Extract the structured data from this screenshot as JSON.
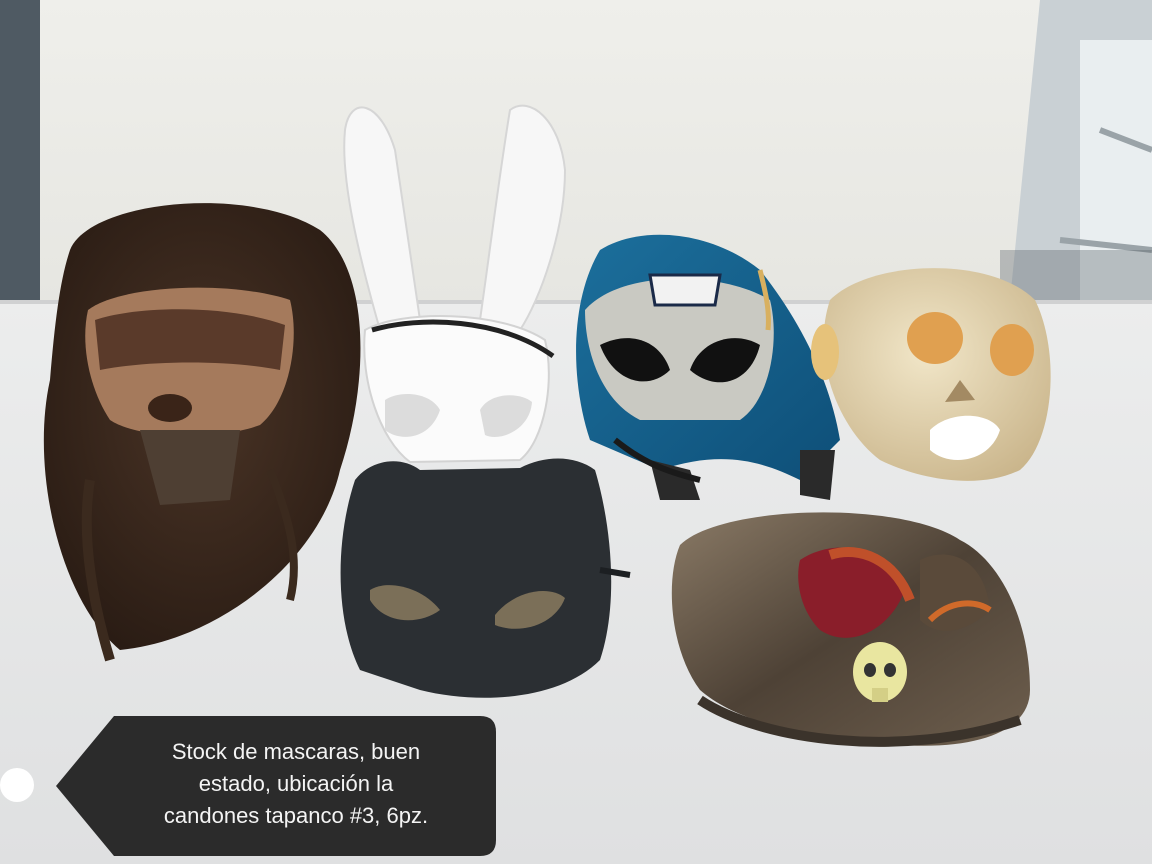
{
  "caption": {
    "line1": "Stock de mascaras, buen",
    "line2": "estado, ubicación la",
    "line3": "candones tapanco #3, 6pz."
  },
  "colors": {
    "wall": "#eeeeea",
    "table": "#e8e9ea",
    "caption_bg": "#2b2b2b",
    "caption_text": "#f4f4f4"
  },
  "objects": [
    "hairy-monster-mask",
    "white-bunny-mask",
    "lucha-libre-mask",
    "skull-face-mask",
    "black-cat-mask",
    "sequin-hat-with-feathers"
  ]
}
